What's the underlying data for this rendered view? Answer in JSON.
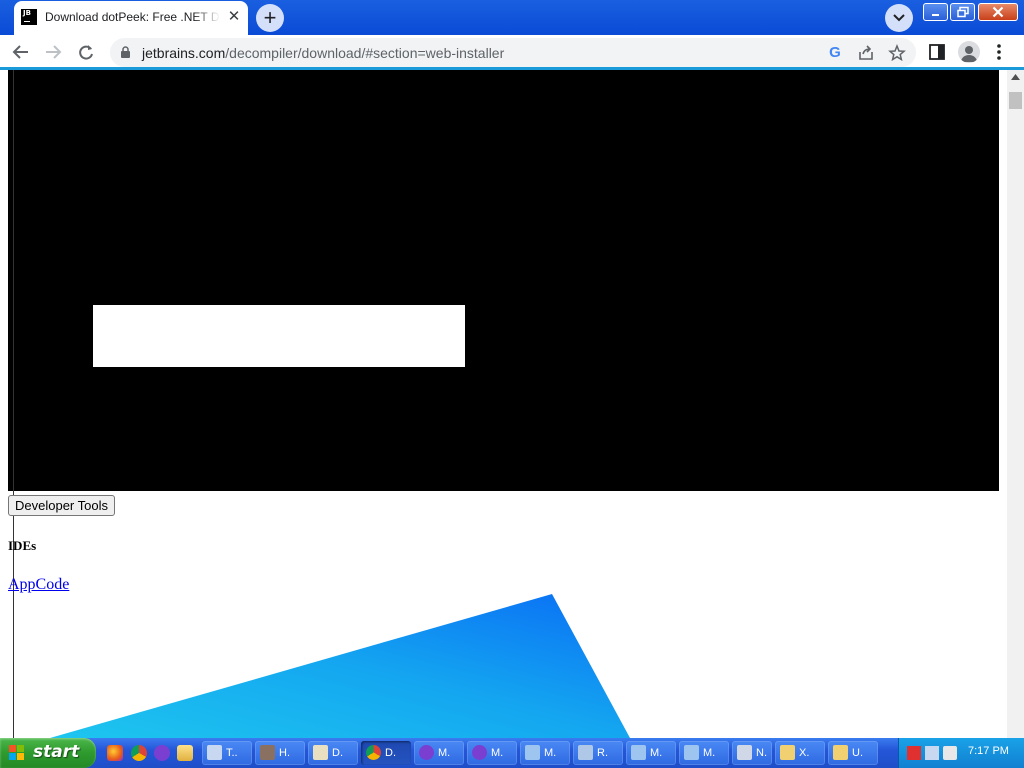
{
  "browser": {
    "tab": {
      "favicon_text": "JB",
      "title": "Download dotPeek: Free .NET Decompiler"
    },
    "address_bar": {
      "host": "jetbrains.com",
      "path": "/decompiler/download/#section=web-installer"
    }
  },
  "page": {
    "developer_tools_button": "Developer Tools",
    "ides_heading": "IDEs",
    "appcode_link": "AppCode"
  },
  "taskbar": {
    "start_label": "start",
    "tasks": [
      "T..",
      "H.",
      "D.",
      "D.",
      "M.",
      "M.",
      "M.",
      "R.",
      "M.",
      "M.",
      "N.",
      "X.",
      "U."
    ],
    "clock": "7:17 PM"
  },
  "colors": {
    "accent": "#1a9ad8",
    "link": "#0000ee",
    "taskbar": "#2456d8",
    "start": "#2e9a2e"
  }
}
